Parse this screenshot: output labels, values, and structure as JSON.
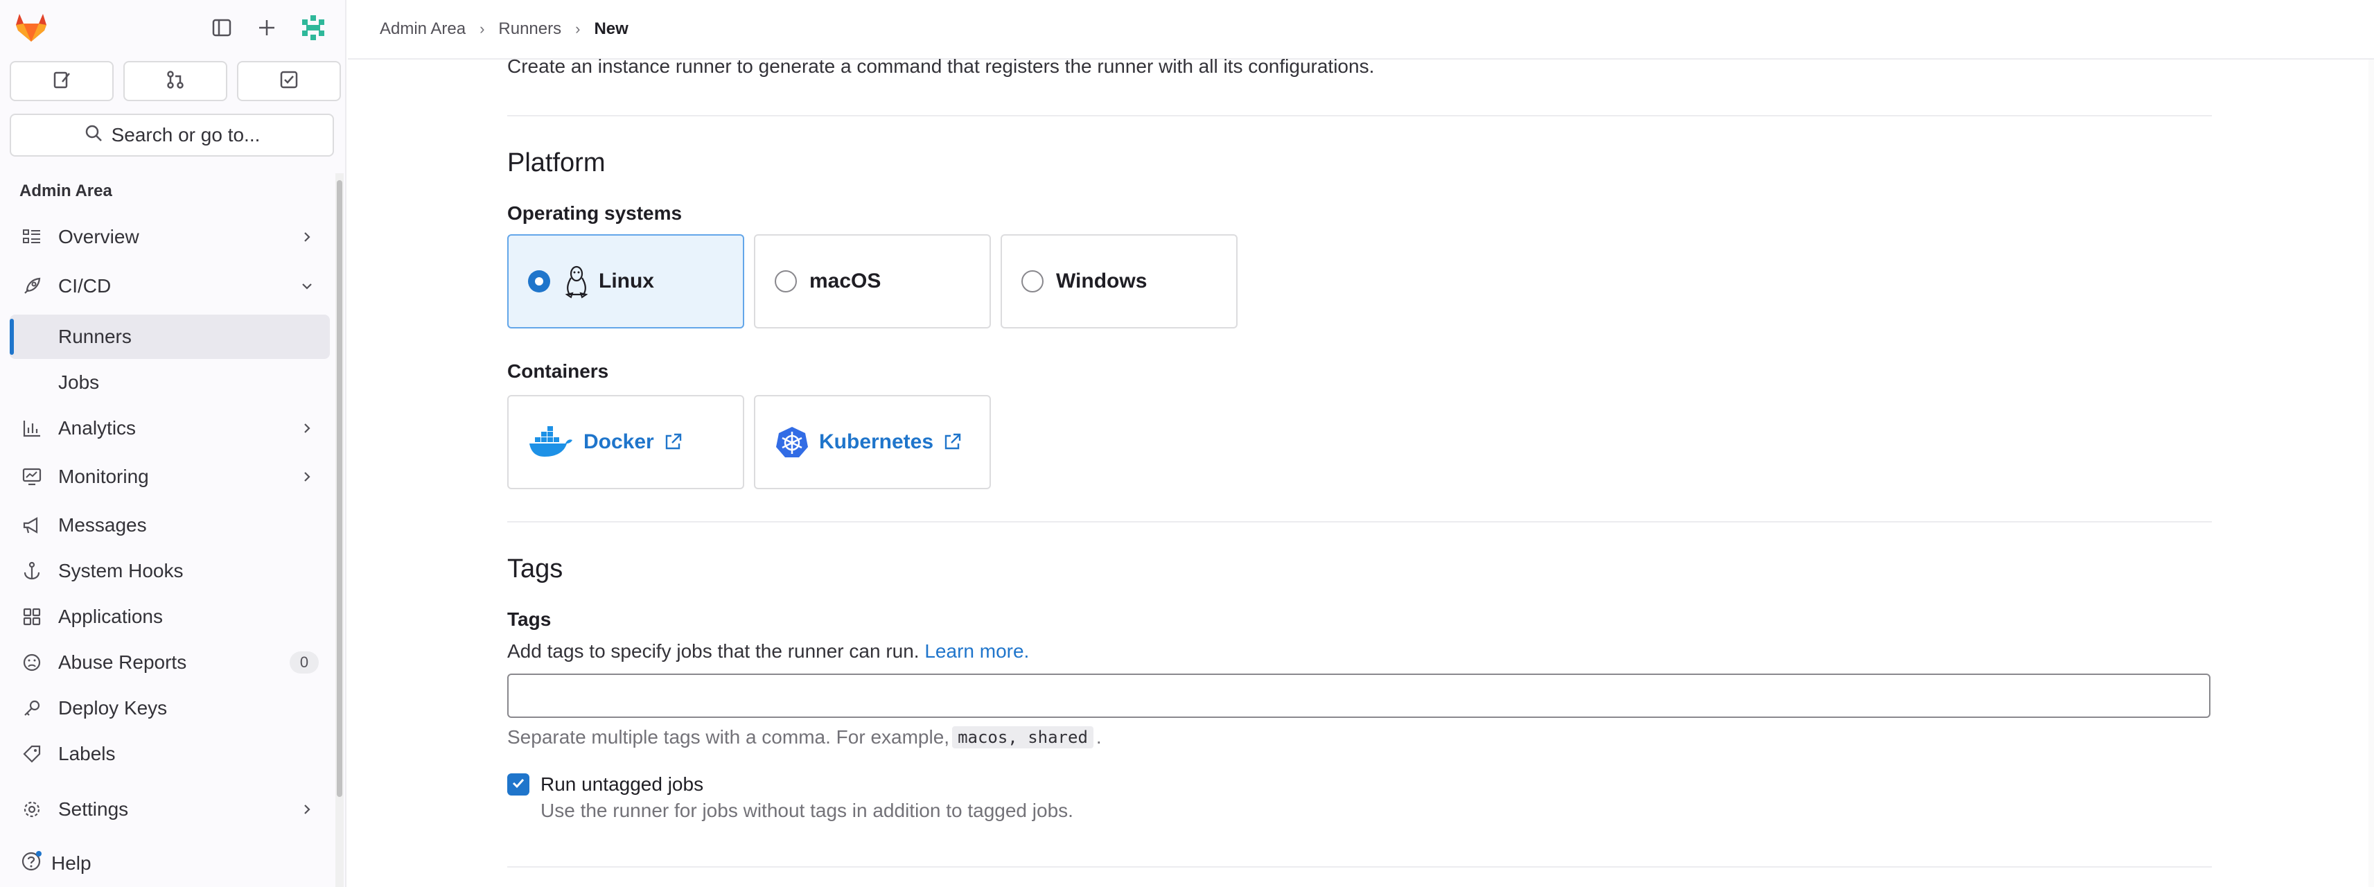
{
  "sidebar": {
    "search_label": "Search or go to...",
    "section_title": "Admin Area",
    "items": [
      {
        "label": "Overview",
        "icon": "overview-icon",
        "expandable": true
      },
      {
        "label": "CI/CD",
        "icon": "rocket-icon",
        "expanded": true
      },
      {
        "label": "Runners",
        "sub": true,
        "active": true
      },
      {
        "label": "Jobs",
        "sub": true
      },
      {
        "label": "Analytics",
        "icon": "chart-icon",
        "expandable": true
      },
      {
        "label": "Monitoring",
        "icon": "monitor-icon",
        "expandable": true
      },
      {
        "label": "Messages",
        "icon": "megaphone-icon"
      },
      {
        "label": "System Hooks",
        "icon": "anchor-icon"
      },
      {
        "label": "Applications",
        "icon": "grid-icon"
      },
      {
        "label": "Abuse Reports",
        "icon": "sad-face-icon",
        "badge": "0"
      },
      {
        "label": "Deploy Keys",
        "icon": "key-icon"
      },
      {
        "label": "Labels",
        "icon": "label-icon"
      },
      {
        "label": "Settings",
        "icon": "gear-icon",
        "expandable": true
      }
    ],
    "help_label": "Help"
  },
  "breadcrumb": [
    "Admin Area",
    "Runners",
    "New"
  ],
  "main": {
    "intro": "Create an instance runner to generate a command that registers the runner with all its configurations.",
    "platform_heading": "Platform",
    "os_label": "Operating systems",
    "os_options": [
      {
        "label": "Linux",
        "selected": true
      },
      {
        "label": "macOS",
        "selected": false
      },
      {
        "label": "Windows",
        "selected": false
      }
    ],
    "containers_label": "Containers",
    "containers": [
      {
        "label": "Docker"
      },
      {
        "label": "Kubernetes"
      }
    ],
    "tags_heading": "Tags",
    "tags_label": "Tags",
    "tags_desc": "Add tags to specify jobs that the runner can run.",
    "learn_more": "Learn more.",
    "tags_value": "",
    "helper_prefix": "Separate multiple tags with a comma. For example,",
    "helper_code": "macos, shared",
    "helper_suffix": ".",
    "untagged_label": "Run untagged jobs",
    "untagged_checked": true,
    "untagged_help": "Use the runner for jobs without tags in addition to tagged jobs."
  },
  "colors": {
    "accent": "#1f75cb",
    "selected_bg": "#e9f3fc"
  }
}
